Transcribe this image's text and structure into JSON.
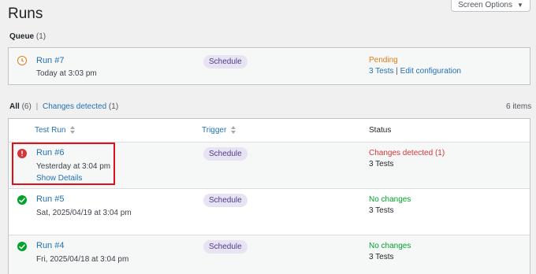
{
  "page": {
    "title": "Runs"
  },
  "screen_options": {
    "label": "Screen Options",
    "caret": "▼"
  },
  "queue": {
    "label": "Queue",
    "count": "(1)",
    "run": {
      "title": "Run #7",
      "time": "Today at 3:03 pm",
      "trigger": "Schedule",
      "status": "Pending",
      "tests": "3 Tests",
      "separator": "|",
      "edit": "Edit configuration"
    }
  },
  "filters": {
    "all_label": "All",
    "all_count": "(6)",
    "separator": "|",
    "changes_label": "Changes detected",
    "changes_count": "(1)",
    "items": "6 items"
  },
  "table": {
    "headers": {
      "run": "Test Run",
      "trigger": "Trigger",
      "status": "Status"
    },
    "rows": [
      {
        "title": "Run #6",
        "time": "Yesterday at 3:04 pm",
        "details": "Show Details",
        "trigger": "Schedule",
        "status": "Changes detected (1)",
        "tests": "3 Tests"
      },
      {
        "title": "Run #5",
        "time": "Sat, 2025/04/19 at 3:04 pm",
        "trigger": "Schedule",
        "status": "No changes",
        "tests": "3 Tests"
      },
      {
        "title": "Run #4",
        "time": "Fri, 2025/04/18 at 3:04 pm",
        "trigger": "Schedule",
        "status": "No changes",
        "tests": "3 Tests"
      }
    ]
  },
  "colors": {
    "pending": "#e07b18",
    "error": "#d63638",
    "success": "#00a32a",
    "link": "#2271b1",
    "highlight": "#e0101a"
  },
  "icons": {
    "pending": "clock-icon",
    "error": "exclamation-icon",
    "success": "check-icon",
    "sort": "sort-arrows-icon"
  }
}
